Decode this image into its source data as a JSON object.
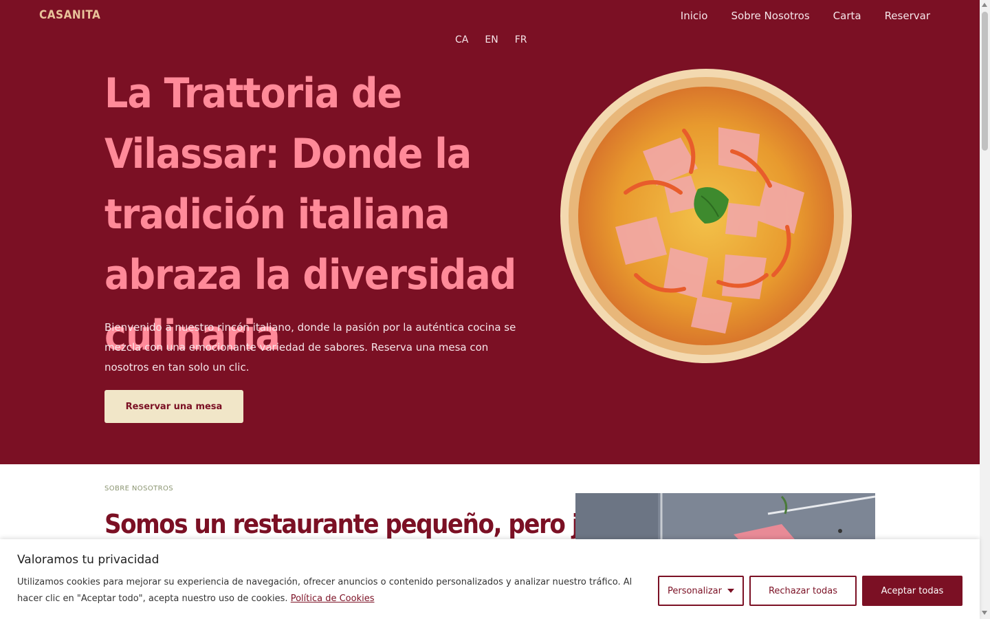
{
  "header": {
    "logo": "CASANITA",
    "nav": [
      "Inicio",
      "Sobre Nosotros",
      "Carta",
      "Reservar"
    ],
    "languages": [
      "CA",
      "EN",
      "FR"
    ]
  },
  "hero": {
    "title": "La Trattoria de Vilassar: Donde la tradición italiana abraza la diversidad culinaria",
    "text": "Bienvenido a nuestro rincón italiano, donde la pasión por la auténtica cocina se mezcla con una emocionante variedad de sabores. Reserva una mesa con nosotros en tan solo un clic.",
    "cta": "Reservar una mesa"
  },
  "about": {
    "eyebrow": "SOBRE NOSOTROS",
    "title": "Somos un restaurante pequeño, pero juntos"
  },
  "cookie": {
    "title": "Valoramos tu privacidad",
    "text": "Utilizamos cookies para mejorar su experiencia de navegación, ofrecer anuncios o contenido personalizados y analizar nuestro tráfico. Al hacer clic en \"Aceptar todo\", acepta nuestro uso de cookies.",
    "policy_link": "Política de Cookies",
    "buttons": {
      "customize": "Personalizar",
      "reject": "Rechazar todas",
      "accept": "Aceptar todas"
    }
  },
  "colors": {
    "brand": "#7b1024",
    "title_pink": "#ff8a99",
    "cta_bg": "#f1e6c8"
  },
  "icons": {
    "hero_image": "pizza-image",
    "customize_caret": "caret-down-icon"
  }
}
